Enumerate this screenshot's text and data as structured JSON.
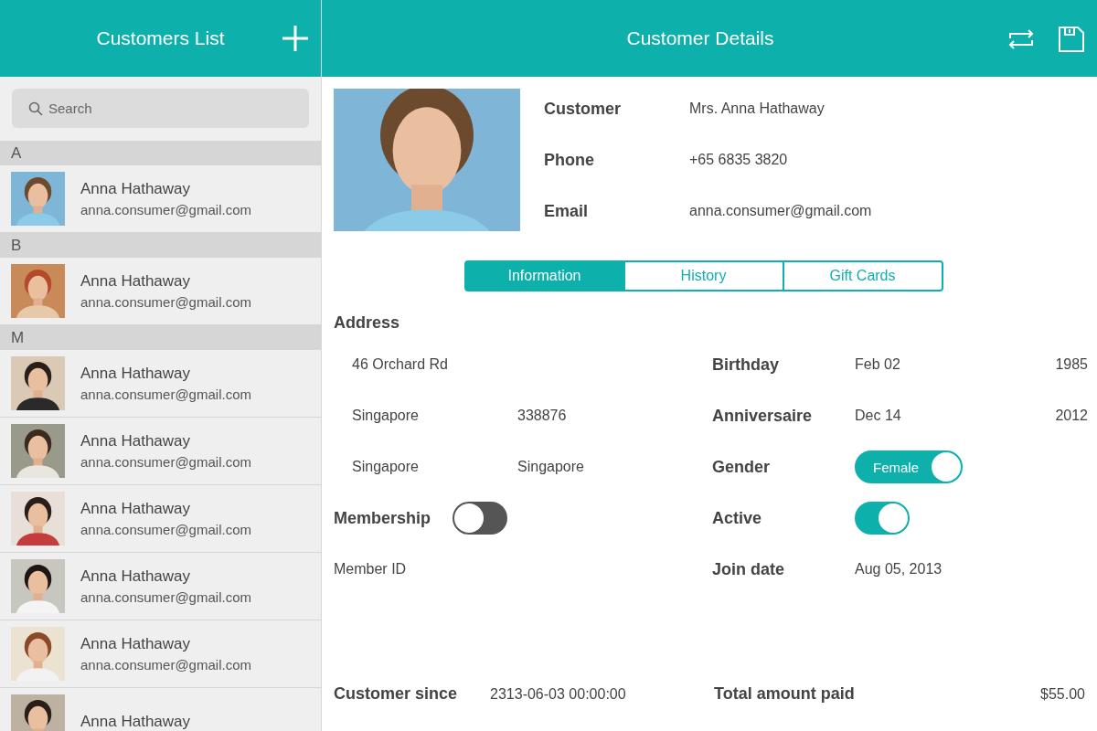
{
  "sidebar": {
    "title": "Customers List",
    "search": {
      "placeholder": "Search"
    },
    "sections": [
      {
        "letter": "A",
        "contacts": [
          {
            "name": "Anna Hathaway",
            "email": "anna.consumer@gmail.com"
          }
        ]
      },
      {
        "letter": "B",
        "contacts": [
          {
            "name": "Anna Hathaway",
            "email": "anna.consumer@gmail.com"
          }
        ]
      },
      {
        "letter": "M",
        "contacts": [
          {
            "name": "Anna Hathaway",
            "email": "anna.consumer@gmail.com"
          },
          {
            "name": "Anna Hathaway",
            "email": "anna.consumer@gmail.com"
          },
          {
            "name": "Anna Hathaway",
            "email": "anna.consumer@gmail.com"
          },
          {
            "name": "Anna Hathaway",
            "email": "anna.consumer@gmail.com"
          },
          {
            "name": "Anna Hathaway",
            "email": "anna.consumer@gmail.com"
          },
          {
            "name": "Anna Hathaway"
          }
        ]
      }
    ]
  },
  "details": {
    "title": "Customer Details",
    "fields": [
      {
        "label": "Customer",
        "value": "Mrs. Anna Hathaway"
      },
      {
        "label": "Phone",
        "value": "+65 6835 3820"
      },
      {
        "label": "Email",
        "value": "anna.consumer@gmail.com"
      }
    ],
    "tabs": [
      {
        "label": "Information",
        "selected": true
      },
      {
        "label": "History",
        "selected": false
      },
      {
        "label": "Gift Cards",
        "selected": false
      }
    ],
    "address": {
      "heading": "Address",
      "lines": [
        [
          "46 Orchard Rd"
        ],
        [
          "Singapore",
          "338876"
        ],
        [
          "Singapore",
          "Singapore"
        ]
      ]
    },
    "membership": {
      "label": "Membership",
      "on": false
    },
    "member_id": {
      "label": "Member ID"
    },
    "info": [
      {
        "kind": "text",
        "label": "Birthday",
        "value": "Feb 02",
        "extra": "1985"
      },
      {
        "kind": "text",
        "label": "Anniversaire",
        "value": "Dec 14",
        "extra": "2012"
      },
      {
        "kind": "toggle",
        "label": "Gender",
        "on": true,
        "text": "Female"
      },
      {
        "kind": "toggle",
        "label": "Active",
        "on": true
      },
      {
        "kind": "text",
        "label": "Join date",
        "value": "Aug 05, 2013"
      }
    ],
    "footer": [
      {
        "label": "Customer since",
        "value": "2313-06-03 00:00:00"
      },
      {
        "label": "Total amount paid",
        "value": "$55.00"
      }
    ]
  }
}
